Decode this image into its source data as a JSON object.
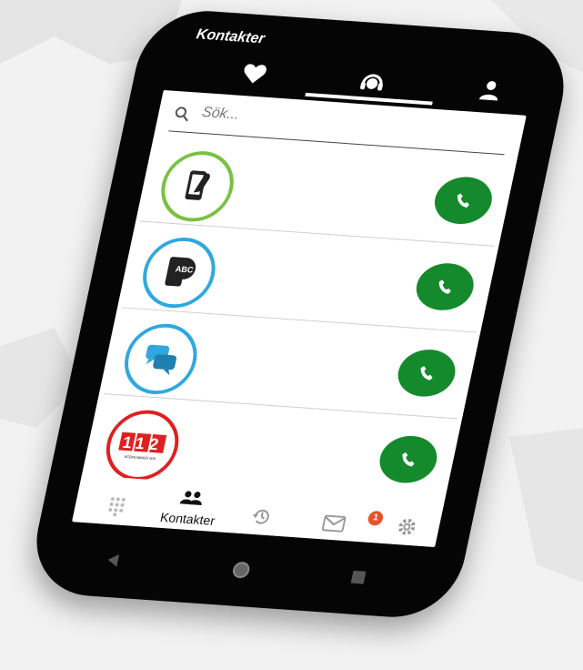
{
  "app": {
    "title": "Kontakter"
  },
  "top_tabs": [
    {
      "name": "favorites",
      "icon": "heart-icon"
    },
    {
      "name": "assistance",
      "icon": "headset-icon"
    },
    {
      "name": "profile",
      "icon": "person-icon"
    }
  ],
  "search": {
    "placeholder": "Sök..."
  },
  "contacts": [
    {
      "icon": "sign-language-phone-icon",
      "ring_color": "#7ac142"
    },
    {
      "icon": "text-phone-abc-icon",
      "ring_color": "#2fa8df"
    },
    {
      "icon": "chat-bubbles-icon",
      "ring_color": "#2fa8df"
    },
    {
      "icon": "emergency-112-icon",
      "ring_color": "#e02020",
      "logo_text": "112",
      "logo_subtext": "NÖDNUMMER 000"
    }
  ],
  "bottom_nav": {
    "dialpad_icon": "dialpad-icon",
    "contacts_label": "Kontakter",
    "history_icon": "history-icon",
    "messages_icon": "mail-icon",
    "messages_badge": "1",
    "settings_icon": "gear-icon"
  },
  "colors": {
    "call_button": "#148a2c",
    "badge": "#e8522a"
  }
}
